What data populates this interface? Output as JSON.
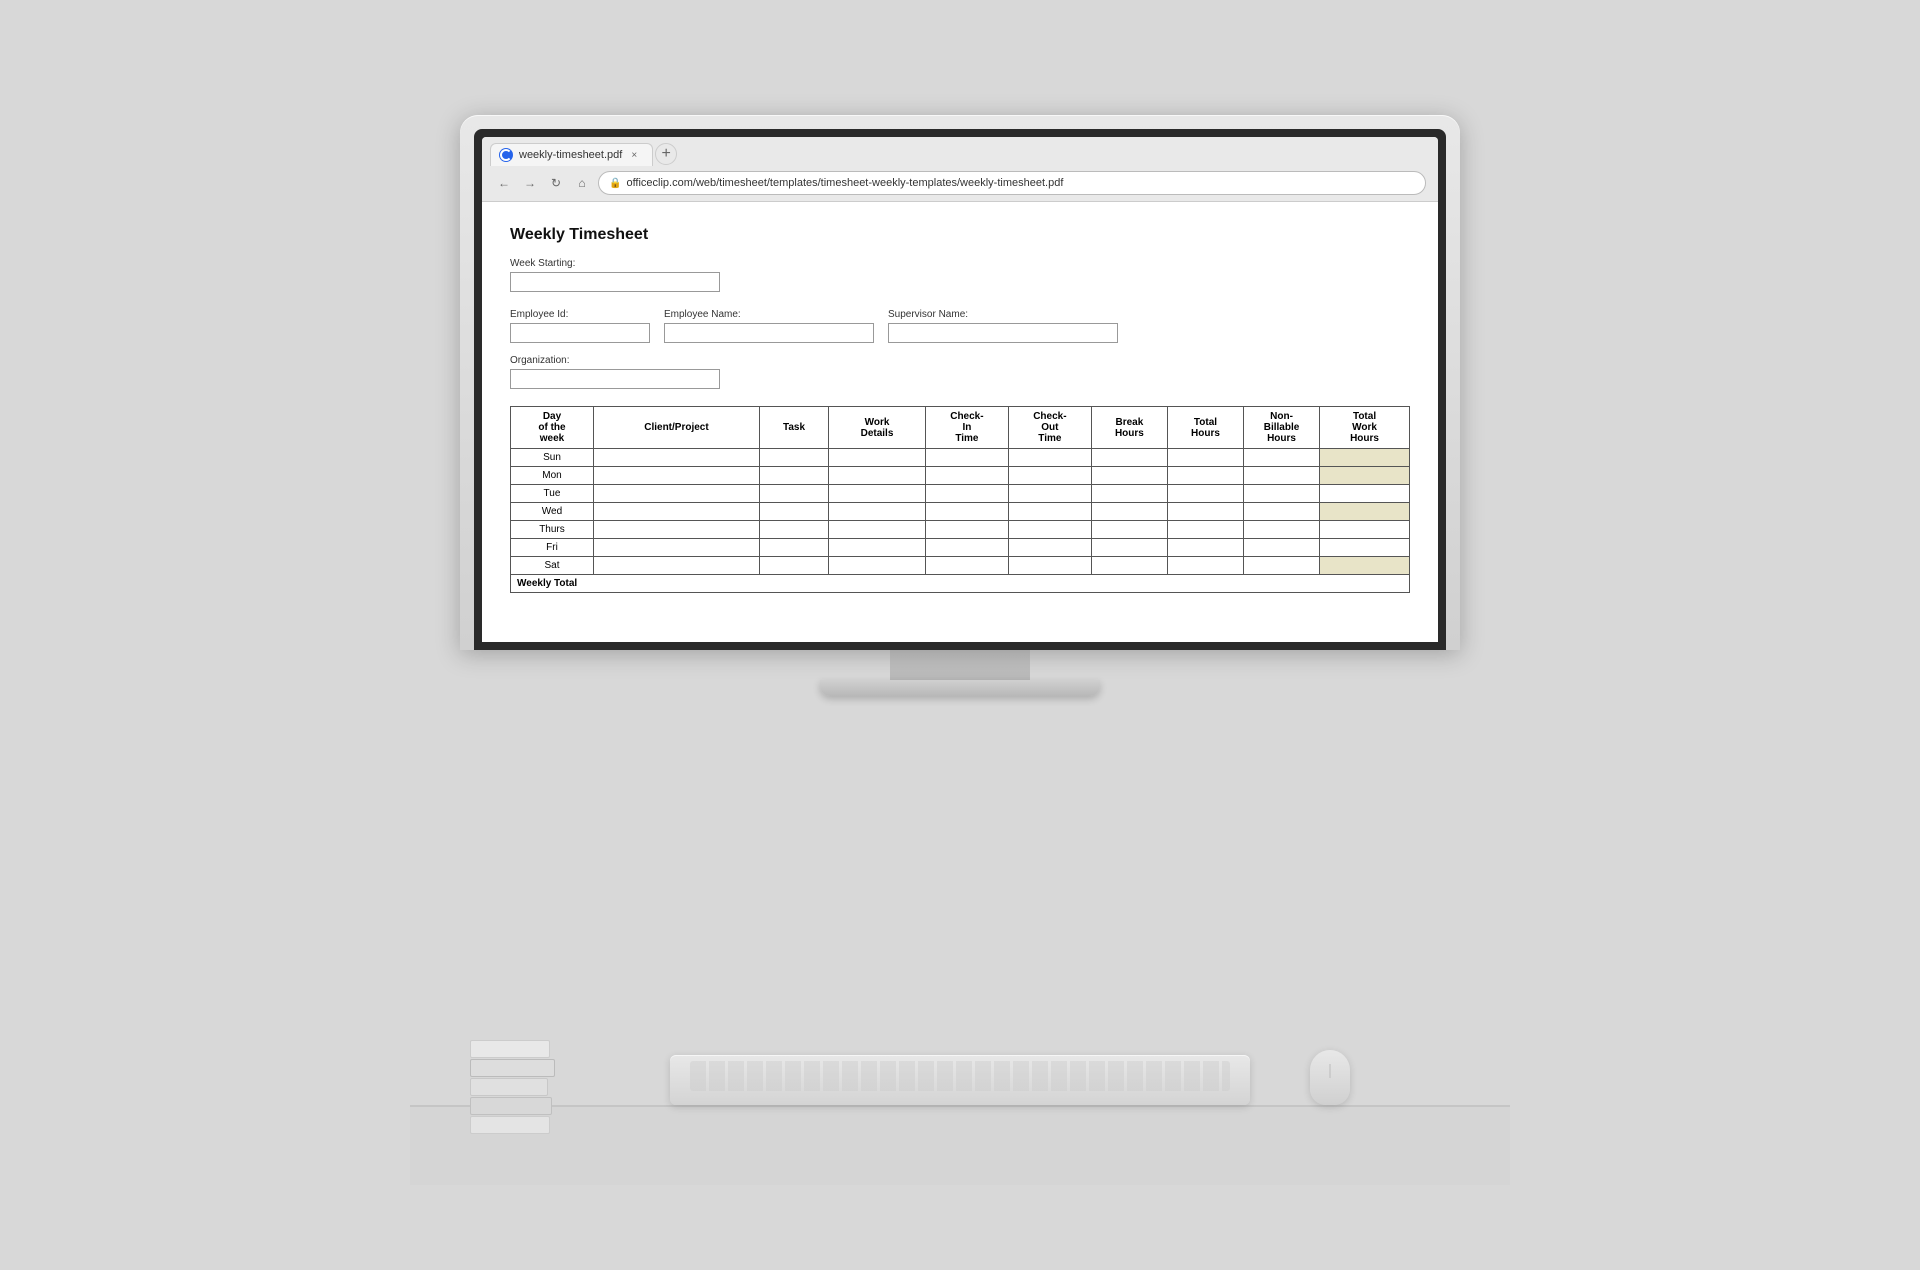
{
  "scene": {
    "background_color": "#d8d8d8"
  },
  "browser": {
    "tab_label": "weekly-timesheet.pdf",
    "tab_close": "×",
    "tab_new": "+",
    "nav": {
      "back": "←",
      "forward": "→",
      "refresh": "↻",
      "home": "⌂"
    },
    "address": "officeclip.com/web/timesheet/templates/timesheet-weekly-templates/weekly-timesheet.pdf"
  },
  "document": {
    "title": "Weekly Timesheet",
    "week_starting_label": "Week Starting:",
    "employee_id_label": "Employee Id:",
    "employee_name_label": "Employee Name:",
    "supervisor_name_label": "Supervisor Name:",
    "organization_label": "Organization:",
    "table": {
      "headers": [
        "Day\nof the\nweek",
        "Client/Project",
        "Task",
        "Work\nDetails",
        "Check-\nIn\nTime",
        "Check-\nOut\nTime",
        "Break\nHours",
        "Total\nHours",
        "Non-\nBillable\nHours",
        "Total\nWork\nHours"
      ],
      "rows": [
        {
          "day": "Sun",
          "shaded": false
        },
        {
          "day": "Mon",
          "shaded": false
        },
        {
          "day": "Tue",
          "shaded": false
        },
        {
          "day": "Wed",
          "shaded": false
        },
        {
          "day": "Thurs",
          "shaded": false
        },
        {
          "day": "Fri",
          "shaded": false
        },
        {
          "day": "Sat",
          "shaded": false
        }
      ],
      "footer_label": "Weekly Total"
    }
  }
}
